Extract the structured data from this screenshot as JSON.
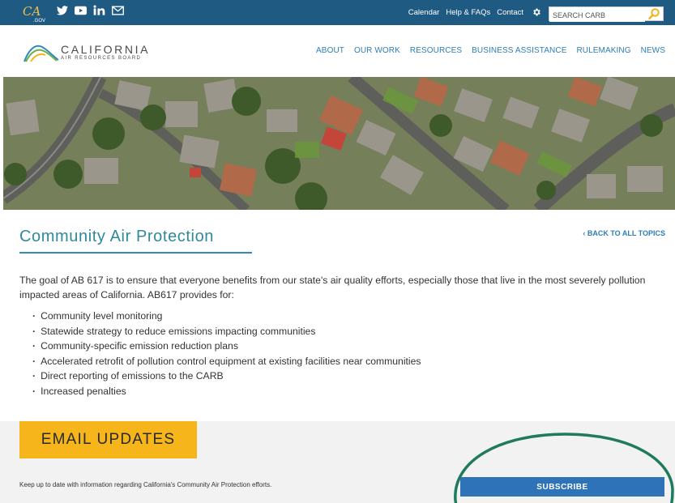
{
  "topbar": {
    "ca_logo": "CA",
    "ca_logo_sub": ".GOV",
    "social": [
      {
        "icon": "twitter-icon",
        "glyph": "🐦"
      },
      {
        "icon": "youtube-icon",
        "glyph": "▶"
      },
      {
        "icon": "linkedin-icon",
        "glyph": "in"
      },
      {
        "icon": "email-icon",
        "glyph": "✉"
      }
    ],
    "links": [
      "Calendar",
      "Help & FAQs",
      "Contact"
    ],
    "search_placeholder": "SEARCH CARB"
  },
  "header": {
    "org_name": "CALIFORNIA",
    "org_sub": "AIR RESOURCES BOARD",
    "nav": [
      "ABOUT",
      "OUR WORK",
      "RESOURCES",
      "BUSINESS ASSISTANCE",
      "RULEMAKING",
      "NEWS"
    ]
  },
  "content": {
    "title": "Community Air Protection",
    "back_link": "‹ BACK TO ALL TOPICS",
    "intro": "The goal of AB 617 is to ensure that everyone benefits from our state's air quality efforts, especially those that live in the most severely pollution impacted areas of California. AB617 provides for:",
    "bullets": [
      "Community level monitoring",
      "Statewide strategy to reduce emissions impacting communities",
      "Community-specific emission reduction plans",
      "Accelerated retrofit of pollution control equipment at existing facilities near  communities",
      "Direct reporting of emissions to the CARB",
      "Increased penalties"
    ]
  },
  "updates": {
    "badge": "EMAIL UPDATES",
    "text": "Keep up to date with information regarding California's Community Air Protection efforts.",
    "subscribe_label": "SUBSCRIBE"
  },
  "colors": {
    "topbar": "#1f5a83",
    "link_blue": "#2e7db6",
    "title_teal": "#2e8a9a",
    "badge_yellow": "#f5b51b",
    "subscribe_blue": "#2e73b8",
    "ring_green": "#1f7a5e"
  }
}
